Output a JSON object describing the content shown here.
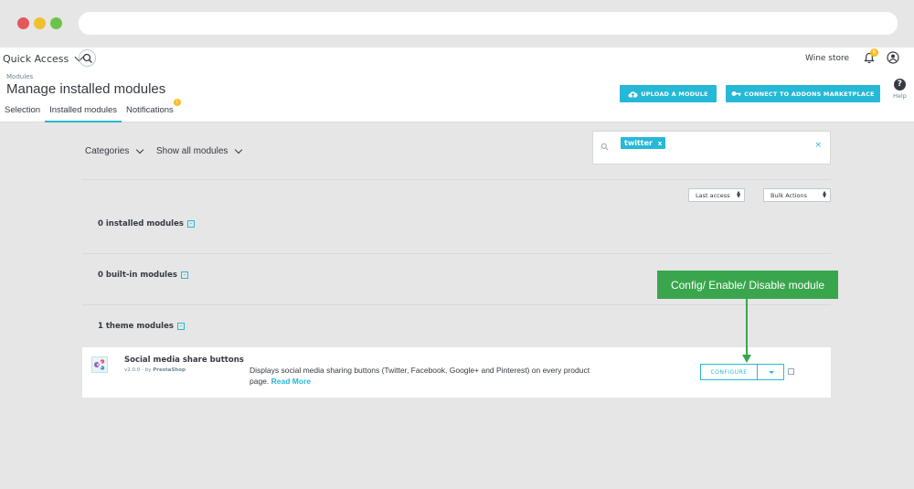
{
  "header": {
    "quick_access": "Quick Access",
    "store": "Wine store",
    "notif_count": "6",
    "breadcrumb": "Modules",
    "title": "Manage installed modules",
    "help": "Help"
  },
  "tabs": [
    {
      "label": "Selection"
    },
    {
      "label": "Installed modules"
    },
    {
      "label": "Notifications",
      "badge": "1"
    }
  ],
  "buttons": {
    "upload": "UPLOAD A MODULE",
    "connect": "CONNECT TO ADDONS MARKETPLACE"
  },
  "filters": {
    "categories": "Categories",
    "show_all": "Show all modules",
    "search_tag": "twitter",
    "tag_remove": "x",
    "clear": "×"
  },
  "sorting": {
    "last_access": "Last access",
    "bulk_actions": "Bulk Actions"
  },
  "sections": [
    {
      "label": "0 installed modules"
    },
    {
      "label": "0 built-in modules"
    },
    {
      "label": "1 theme modules"
    }
  ],
  "module": {
    "name": "Social media share buttons",
    "version": "v2.0.0 - by ",
    "author": "PrestaShop",
    "description": "Displays social media sharing buttons (Twitter, Facebook, Google+ and Pinterest) on every product page.",
    "read_more": "Read More",
    "configure": "CONFIGURE"
  },
  "callout": {
    "text": "Config/ Enable/ Disable module"
  },
  "colors": {
    "accent": "#25b9d7",
    "callout": "#39a64d",
    "badge": "#fbbb22"
  }
}
